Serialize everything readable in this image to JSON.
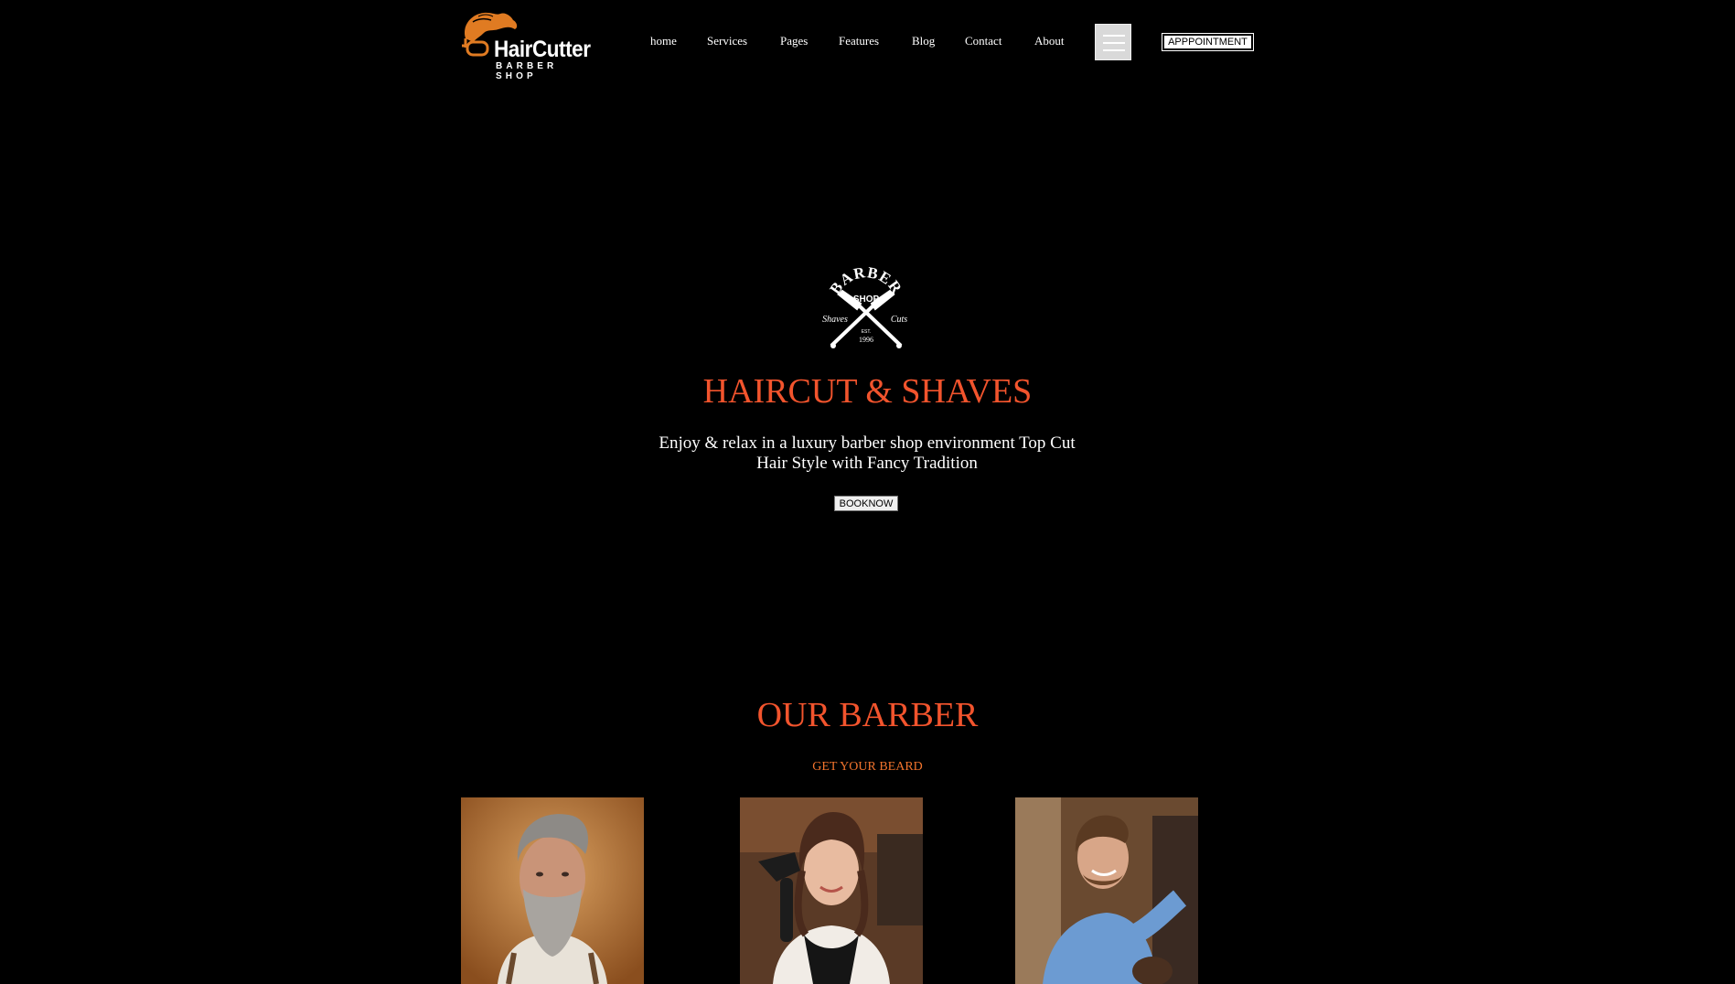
{
  "header": {
    "logo": {
      "name": "HairCutter",
      "tagline": "BARBER SHOP"
    },
    "nav": [
      {
        "label": "home"
      },
      {
        "label": "Services"
      },
      {
        "label": "Pages"
      },
      {
        "label": "Features"
      },
      {
        "label": "Blog"
      },
      {
        "label": "Contact"
      },
      {
        "label": "About"
      }
    ],
    "menu_icon": "hamburger-icon",
    "appointment_label": "APPPOINTMENT"
  },
  "hero": {
    "badge": {
      "top_text": "BARBER",
      "middle_text": "SHOP",
      "left_text": "Shaves",
      "right_text": "Cuts",
      "est": "EST.",
      "year": "1996"
    },
    "title": "HAIRCUT & SHAVES",
    "text": "Enjoy & relax in a luxury barber shop environment Top Cut Hair Style with Fancy Tradition",
    "button_label": "BOOKNOW"
  },
  "barbers": {
    "title": "OUR BARBER",
    "subtitle": "GET YOUR BEARD",
    "photos": [
      {
        "icon": "bearded-barber-photo"
      },
      {
        "icon": "female-stylist-photo"
      },
      {
        "icon": "smiling-barber-photo"
      }
    ]
  },
  "colors": {
    "background": "#000000",
    "accent": "#f2542d",
    "subtitle": "#f2742d",
    "logo_accent": "#e07b22"
  }
}
